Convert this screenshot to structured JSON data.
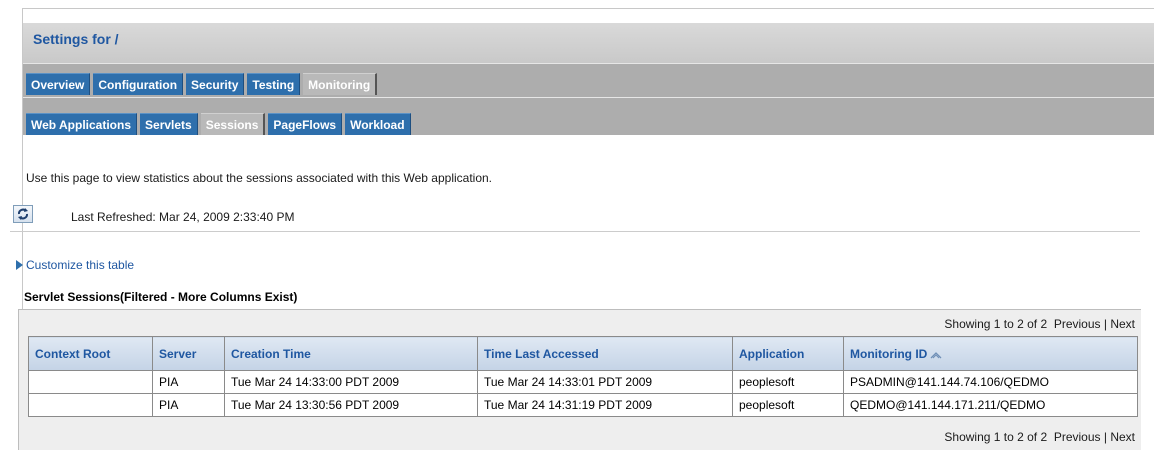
{
  "header": {
    "title": "Settings for /"
  },
  "main_tabs": [
    {
      "label": "Overview",
      "active": false
    },
    {
      "label": "Configuration",
      "active": false
    },
    {
      "label": "Security",
      "active": false
    },
    {
      "label": "Testing",
      "active": false
    },
    {
      "label": "Monitoring",
      "active": true
    }
  ],
  "sub_tabs": [
    {
      "label": "Web Applications",
      "active": false
    },
    {
      "label": "Servlets",
      "active": false
    },
    {
      "label": "Sessions",
      "active": true
    },
    {
      "label": "PageFlows",
      "active": false
    },
    {
      "label": "Workload",
      "active": false
    }
  ],
  "description": "Use this page to view statistics about the sessions associated with this Web application.",
  "refresh": {
    "icon": "refresh-icon",
    "text": "Last Refreshed: Mar 24, 2009 2:33:40 PM"
  },
  "customize": {
    "icon": "expand-triangle-icon",
    "label": "Customize this table"
  },
  "table": {
    "title": "Servlet Sessions(Filtered - More Columns Exist)",
    "pager": {
      "showing": "Showing 1 to 2 of 2",
      "previous": "Previous",
      "separator": "|",
      "next": "Next"
    },
    "columns": [
      "Context Root",
      "Server",
      "Creation Time",
      "Time Last Accessed",
      "Application",
      "Monitoring ID"
    ],
    "sorted_column_icon": "sort-ascending-icon",
    "rows": [
      [
        "",
        "PIA",
        "Tue Mar 24 14:33:00 PDT 2009",
        "Tue Mar 24 14:33:01 PDT 2009",
        "peoplesoft",
        "PSADMIN@141.144.74.106/QEDMO"
      ],
      [
        "",
        "PIA",
        "Tue Mar 24 13:30:56 PDT 2009",
        "Tue Mar 24 14:31:19 PDT 2009",
        "peoplesoft",
        "QEDMO@141.144.171.211/QEDMO"
      ]
    ]
  },
  "colors": {
    "tab_blue": "#2e6fac",
    "link_blue": "#1f57a1",
    "tab_bar_gray": "#adadad"
  }
}
